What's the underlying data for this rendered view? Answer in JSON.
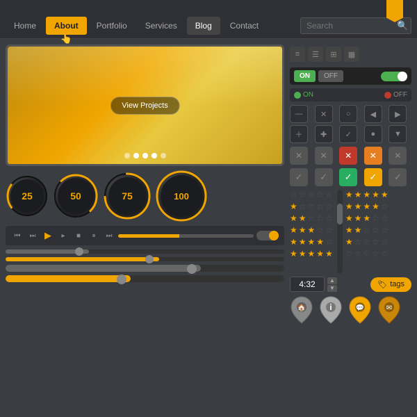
{
  "ribbon": {
    "bookmark_color": "#f0a500"
  },
  "nav": {
    "items": [
      {
        "label": "Home",
        "state": "normal"
      },
      {
        "label": "About",
        "state": "active"
      },
      {
        "label": "Portfolio",
        "state": "normal"
      },
      {
        "label": "Services",
        "state": "normal"
      },
      {
        "label": "Blog",
        "state": "blog-active"
      },
      {
        "label": "Contact",
        "state": "normal"
      }
    ],
    "search_placeholder": "Search"
  },
  "video": {
    "btn_label": "View Projects",
    "dots": [
      false,
      true,
      true,
      true,
      false
    ]
  },
  "knobs": [
    {
      "value": "25",
      "percent": 25
    },
    {
      "value": "50",
      "percent": 50
    },
    {
      "value": "75",
      "percent": 75
    },
    {
      "value": "100",
      "percent": 100
    }
  ],
  "controls": {
    "transport": [
      "⏮",
      "⏭",
      "▶",
      "▸",
      "■",
      "⏸",
      "⏭"
    ],
    "volume_pct": 45
  },
  "view_icons": [
    "≡",
    "☰",
    "⊞",
    "▦"
  ],
  "toggles": {
    "on_label": "ON",
    "off_label": "OFF",
    "radio_on": "ON",
    "radio_off": "OFF"
  },
  "grid_buttons": [
    "—",
    "✕",
    "○",
    "◀",
    "▶",
    "＋",
    "✚",
    "✓",
    "●",
    "▼"
  ],
  "x_buttons": [
    {
      "symbol": "✕",
      "style": "gray"
    },
    {
      "symbol": "✕",
      "style": "gray"
    },
    {
      "symbol": "✕",
      "style": "red"
    },
    {
      "symbol": "✕",
      "style": "orange"
    },
    {
      "symbol": "✕",
      "style": "gray"
    }
  ],
  "check_buttons": [
    {
      "symbol": "✓",
      "style": "gray"
    },
    {
      "symbol": "✓",
      "style": "gray"
    },
    {
      "symbol": "✓",
      "style": "green"
    },
    {
      "symbol": "✓",
      "style": "orange"
    },
    {
      "symbol": "✓",
      "style": "gray"
    }
  ],
  "star_rows": [
    [
      false,
      false,
      false,
      false,
      false
    ],
    [
      true,
      false,
      false,
      false,
      false
    ],
    [
      true,
      true,
      false,
      false,
      false
    ],
    [
      true,
      true,
      true,
      false,
      false
    ],
    [
      true,
      true,
      true,
      true,
      false
    ],
    [
      true,
      true,
      true,
      true,
      true
    ]
  ],
  "star_rows_right": [
    [
      true,
      true,
      true,
      true,
      true
    ],
    [
      true,
      true,
      true,
      true,
      false
    ],
    [
      true,
      true,
      true,
      false,
      false
    ],
    [
      true,
      true,
      false,
      false,
      false
    ],
    [
      true,
      false,
      false,
      false,
      false
    ],
    [
      false,
      false,
      false,
      false,
      false
    ]
  ],
  "sliders": [
    {
      "fill_pct": 30,
      "style": "dark"
    },
    {
      "fill_pct": 55,
      "style": "orange"
    },
    {
      "fill_pct": 70,
      "style": "gray"
    },
    {
      "fill_pct": 45,
      "style": "orange"
    }
  ],
  "time": {
    "value": "4:32"
  },
  "tag": {
    "label": "tags"
  },
  "pins": [
    {
      "icon": "🏠",
      "color": "gray"
    },
    {
      "icon": "ℹ",
      "color": "blue"
    },
    {
      "icon": "💬",
      "color": "yellow"
    },
    {
      "icon": "✉",
      "color": "yellow-dark"
    }
  ]
}
